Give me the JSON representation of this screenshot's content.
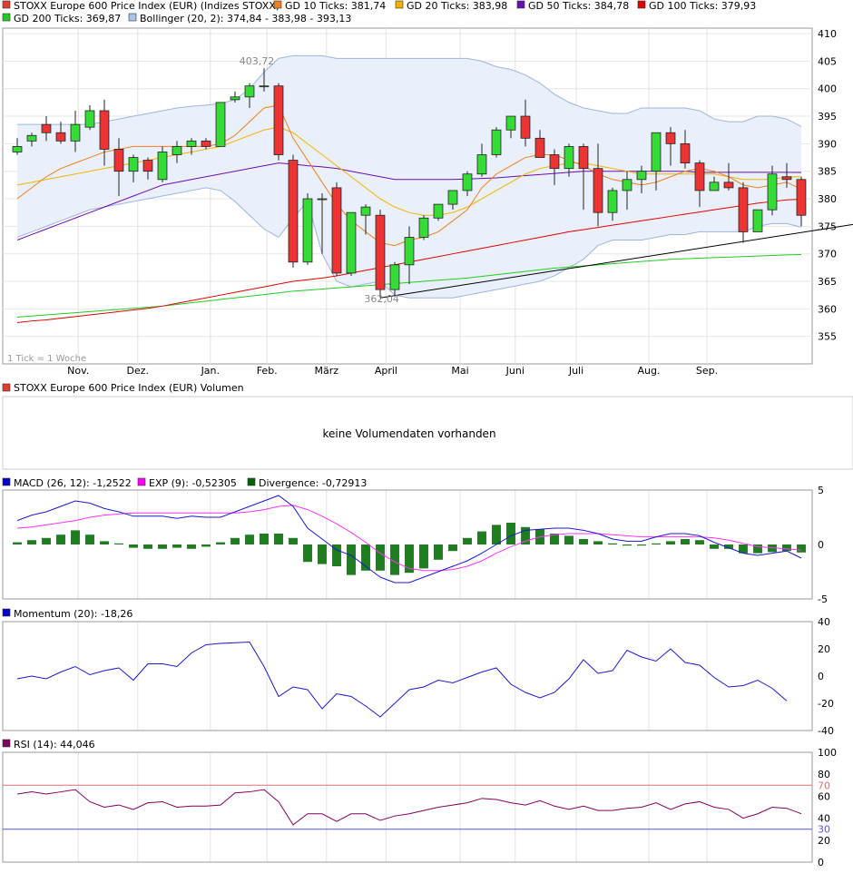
{
  "legend_main": [
    {
      "label": "STOXX Europe 600 Price Index (EUR) (Indizes STOXX)",
      "color": "#e03c31"
    },
    {
      "label": "GD 10 Ticks: 381,74",
      "color": "#f07f1f"
    },
    {
      "label": "GD 20 Ticks: 383,98",
      "color": "#f0b400"
    },
    {
      "label": "GD 50 Ticks: 384,78",
      "color": "#6a0dad"
    },
    {
      "label": "GD 100 Ticks: 379,93",
      "color": "#e00000"
    },
    {
      "label": "GD 200 Ticks: 369,87",
      "color": "#22cc22"
    },
    {
      "label": "Bollinger (20, 2): 374,84 - 383,98 - 393,13",
      "color": "#a9c4e8"
    }
  ],
  "price_axis": [
    "410",
    "405",
    "400",
    "395",
    "390",
    "385",
    "380",
    "375",
    "370",
    "365",
    "360",
    "355"
  ],
  "months": [
    "Nov.",
    "Dez.",
    "Jan.",
    "Feb.",
    "März",
    "April",
    "Mai",
    "Juni",
    "Juli",
    "Aug.",
    "Sep."
  ],
  "tick_note": "1 Tick = 1 Woche",
  "high_label": "403,72",
  "low_label": "362,04",
  "volume_title": "STOXX Europe 600 Price Index (EUR) Volumen",
  "volume_empty": "keine Volumendaten vorhanden",
  "macd_legend": [
    {
      "label": "MACD (26, 12): -1,2522",
      "color": "#0000cc"
    },
    {
      "label": "EXP (9): -0,52305",
      "color": "#ff00ff"
    },
    {
      "label": "Divergence: -0,72913",
      "color": "#006400"
    }
  ],
  "macd_axis": [
    "5",
    "0",
    "-5"
  ],
  "momentum_legend": {
    "label": "Momentum (20): -18,26",
    "color": "#0000cc"
  },
  "momentum_axis": [
    "40",
    "20",
    "0",
    "-20",
    "-40"
  ],
  "rsi_legend": {
    "label": "RSI (14): 44,046",
    "color": "#800060"
  },
  "rsi_axis": [
    "100",
    "80",
    "70",
    "60",
    "40",
    "30",
    "20",
    "0"
  ],
  "chart_data": [
    {
      "type": "candlestick",
      "title": "STOXX Europe 600 Price Index (EUR) (Indizes STOXX)",
      "ylim": [
        350,
        411
      ],
      "grid": true,
      "candles": [
        [
          388.5,
          391,
          388,
          389.5
        ],
        [
          390.5,
          392,
          389.5,
          391.5
        ],
        [
          393.5,
          395,
          390.5,
          392
        ],
        [
          392,
          394,
          390,
          390.5
        ],
        [
          390.5,
          396,
          388.5,
          393.5
        ],
        [
          393,
          397,
          392.5,
          396
        ],
        [
          396,
          398,
          386,
          389
        ],
        [
          389,
          391,
          380.5,
          385
        ],
        [
          385,
          388,
          383,
          387.5
        ],
        [
          387,
          387.5,
          383.5,
          385
        ],
        [
          383.5,
          389.5,
          383,
          388.5
        ],
        [
          388,
          390.5,
          386.5,
          389.5
        ],
        [
          389.5,
          391,
          388,
          390.5
        ],
        [
          390.5,
          391,
          389,
          389.5
        ],
        [
          389.5,
          396.5,
          389.5,
          397.5
        ],
        [
          398,
          399.5,
          397.5,
          398.5
        ],
        [
          398.5,
          401,
          396.5,
          400.5
        ],
        [
          400.5,
          403.7,
          399.5,
          400.5
        ],
        [
          400.5,
          401,
          387,
          388
        ],
        [
          387,
          388,
          367.5,
          368.5
        ],
        [
          368.5,
          381,
          368,
          380
        ],
        [
          380,
          381,
          370,
          380
        ],
        [
          382,
          383,
          366,
          366.5
        ],
        [
          366.5,
          377,
          366,
          377.5
        ],
        [
          377,
          379,
          373.5,
          378.5
        ],
        [
          377,
          378,
          362,
          363.5
        ],
        [
          363.5,
          368.5,
          362.5,
          368
        ],
        [
          368,
          375,
          364.5,
          373
        ],
        [
          373,
          377,
          372.5,
          376.5
        ],
        [
          376.5,
          379,
          376,
          379
        ],
        [
          379,
          381,
          378,
          381.5
        ],
        [
          381.5,
          385,
          380.5,
          384.5
        ],
        [
          384.5,
          390,
          384,
          388
        ],
        [
          388,
          393,
          387.5,
          392.5
        ],
        [
          392.5,
          395,
          391,
          395
        ],
        [
          395,
          398,
          389.5,
          391
        ],
        [
          391,
          392.5,
          387.5,
          387.5
        ],
        [
          388,
          389,
          382.5,
          385.5
        ],
        [
          385.5,
          390,
          384,
          389.5
        ],
        [
          389.5,
          390,
          378,
          385.5
        ],
        [
          385.5,
          390,
          375,
          377.5
        ],
        [
          377.5,
          382,
          376,
          381.5
        ],
        [
          381.5,
          385,
          378,
          383.5
        ],
        [
          383.5,
          386,
          381,
          385
        ],
        [
          385,
          388,
          381.5,
          392
        ],
        [
          392,
          393,
          386,
          390
        ],
        [
          390,
          392.5,
          385.5,
          386.5
        ],
        [
          386.5,
          387,
          378.5,
          381.5
        ],
        [
          381.5,
          384,
          381.5,
          383
        ],
        [
          383,
          386.5,
          381.5,
          382
        ],
        [
          382,
          383,
          372,
          374
        ],
        [
          374,
          377.5,
          374,
          378
        ],
        [
          378,
          386,
          377,
          384.5
        ],
        [
          384,
          386.5,
          382,
          383.5
        ],
        [
          383.5,
          384,
          375,
          377
        ]
      ],
      "gd10": [
        380,
        382,
        384,
        385.5,
        386.5,
        387.5,
        388.5,
        389,
        389.5,
        389.5,
        389.5,
        389.5,
        389.5,
        389.5,
        390,
        391.5,
        394,
        396.5,
        397,
        391,
        387,
        383,
        379,
        376,
        374,
        372,
        371.5,
        372.5,
        373,
        374,
        376,
        378,
        382,
        384.5,
        386,
        387.5,
        388,
        388,
        387,
        386,
        384.5,
        383.5,
        383,
        382.5,
        383,
        384,
        385,
        385.5,
        385,
        384,
        382.5,
        382,
        382.5,
        383,
        381.74
      ],
      "gd20": [
        382.5,
        383,
        383.5,
        384,
        384.5,
        385,
        385.5,
        386,
        386.5,
        387,
        387.5,
        388,
        388.5,
        389,
        389.5,
        390.5,
        391.5,
        392.5,
        393,
        392,
        390,
        388,
        386,
        384,
        382,
        380,
        378.5,
        377.5,
        377,
        377,
        377.5,
        378.5,
        380,
        381.5,
        383,
        384.5,
        385.5,
        386,
        386.5,
        386.5,
        386,
        385.5,
        385,
        384.5,
        384.5,
        384.5,
        384.5,
        384.5,
        384.5,
        384,
        383.5,
        383.5,
        383.5,
        384,
        383.98
      ],
      "gd50": [
        372.5,
        373.5,
        374.5,
        375.5,
        376.5,
        377.5,
        378.5,
        379.5,
        380.5,
        381.5,
        382.5,
        383,
        383.5,
        384,
        384.5,
        385,
        385.5,
        386,
        386.5,
        386.3,
        386,
        385.8,
        385.5,
        385,
        384.5,
        384,
        383.5,
        383.5,
        383.5,
        383.5,
        383.5,
        383.6,
        383.7,
        383.8,
        384,
        384.2,
        384.4,
        384.6,
        384.8,
        385,
        385,
        385,
        385,
        385,
        385,
        385,
        385,
        384.8,
        384.8,
        384.8,
        384.8,
        384.8,
        384.8,
        384.8,
        384.78
      ],
      "gd100": [
        357.5,
        357.8,
        358,
        358.3,
        358.6,
        358.9,
        359.2,
        359.5,
        359.8,
        360.1,
        360.5,
        361,
        361.5,
        362,
        362.5,
        363,
        363.5,
        364,
        364.5,
        365,
        365.3,
        365.6,
        366,
        366.5,
        367,
        367.5,
        368,
        368.5,
        369,
        369.5,
        370,
        370.5,
        371,
        371.5,
        372,
        372.5,
        373,
        373.5,
        374,
        374.4,
        374.8,
        375.2,
        375.6,
        376,
        376.4,
        376.8,
        377.2,
        377.6,
        378,
        378.4,
        378.8,
        379.2,
        379.5,
        379.8,
        379.93
      ],
      "gd200": [
        358.5,
        358.7,
        358.9,
        359.1,
        359.3,
        359.5,
        359.7,
        359.9,
        360.1,
        360.3,
        360.5,
        360.8,
        361.1,
        361.4,
        361.7,
        362,
        362.3,
        362.6,
        362.9,
        363.2,
        363.4,
        363.6,
        363.8,
        364,
        364.2,
        364.4,
        364.6,
        364.8,
        365,
        365.2,
        365.4,
        365.6,
        365.9,
        366.2,
        366.5,
        366.8,
        367.1,
        367.4,
        367.6,
        367.8,
        368,
        368.2,
        368.4,
        368.6,
        368.8,
        369,
        369.1,
        369.2,
        369.3,
        369.4,
        369.5,
        369.6,
        369.7,
        369.8,
        369.87
      ],
      "boll_upper": [
        393.5,
        393.5,
        393.5,
        393.5,
        393.5,
        393.5,
        394,
        394.5,
        395,
        395.5,
        396,
        396.5,
        396.8,
        397,
        397.3,
        398,
        400,
        403,
        405.5,
        406,
        406,
        406,
        405.5,
        405.5,
        405.5,
        405.5,
        405.5,
        405.5,
        405.5,
        405.5,
        405.5,
        405.5,
        405,
        404,
        403.5,
        402.5,
        401,
        399,
        397.5,
        396.5,
        396,
        395.5,
        395.5,
        396.5,
        396.5,
        396.5,
        396.5,
        396,
        394.5,
        394,
        394,
        395,
        395,
        394.5,
        393.13
      ],
      "boll_lower": [
        373,
        374,
        375,
        376,
        377,
        378,
        378.5,
        379,
        379.5,
        380,
        380.5,
        381,
        381.5,
        382,
        381.5,
        379.5,
        377,
        374.5,
        373,
        376.5,
        379.5,
        370,
        365,
        364,
        364.5,
        365,
        362.5,
        362,
        362,
        362,
        362,
        362.5,
        363,
        363.5,
        364,
        364.5,
        365,
        366,
        367.5,
        369,
        371.5,
        372.5,
        372.5,
        372.5,
        373,
        373.5,
        373.5,
        374,
        374,
        374,
        374,
        375,
        375.5,
        375.5,
        374.84
      ],
      "trendline": [
        [
          25,
          362
        ],
        [
          55,
          374.5
        ]
      ]
    },
    {
      "type": "line",
      "title": "MACD (26, 12)",
      "ylim": [
        -5,
        5
      ],
      "macd": [
        2.2,
        2.7,
        3,
        3.5,
        4,
        3.8,
        3.3,
        3,
        2.6,
        2.6,
        2.6,
        2.4,
        2.6,
        2.5,
        2.5,
        3,
        3.5,
        4,
        4.5,
        3.5,
        1.5,
        0.5,
        -0.5,
        -1,
        -2,
        -3,
        -3.5,
        -3.5,
        -3,
        -2.5,
        -2,
        -1.5,
        -0.8,
        0,
        0.8,
        1.3,
        1.4,
        1.5,
        1.5,
        1.3,
        1,
        0.5,
        0.3,
        0.3,
        0.7,
        1,
        1,
        0.8,
        0.2,
        -0.3,
        -0.8,
        -1,
        -0.8,
        -0.6,
        -1.25
      ],
      "exp": [
        1.5,
        1.6,
        1.8,
        2,
        2.2,
        2.5,
        2.7,
        2.8,
        2.9,
        2.9,
        2.9,
        2.9,
        2.9,
        2.9,
        2.9,
        2.9,
        3,
        3.2,
        3.5,
        3.6,
        3.2,
        2.6,
        1.9,
        1.1,
        0.2,
        -0.8,
        -1.6,
        -2.2,
        -2.4,
        -2.4,
        -2.3,
        -2,
        -1.5,
        -0.8,
        -0.2,
        0.3,
        0.7,
        0.9,
        1,
        1,
        1,
        0.9,
        0.8,
        0.7,
        0.7,
        0.7,
        0.7,
        0.7,
        0.6,
        0.4,
        0.1,
        -0.2,
        -0.3,
        -0.4,
        -0.52
      ],
      "divergence": [
        0.2,
        0.4,
        0.6,
        0.9,
        1.3,
        0.9,
        0.3,
        0.1,
        -0.3,
        -0.4,
        -0.4,
        -0.3,
        -0.4,
        -0.2,
        0.2,
        0.6,
        0.9,
        1,
        1,
        0.6,
        -1.6,
        -1.8,
        -2,
        -2.8,
        -2.4,
        -2.4,
        -2.8,
        -2.6,
        -2.2,
        -1.4,
        -0.6,
        0.6,
        1.2,
        1.8,
        2,
        1.6,
        1.4,
        1,
        0.8,
        0.5,
        0.3,
        0.1,
        -0.1,
        -0.1,
        0.1,
        0.3,
        0.5,
        0.4,
        -0.4,
        -0.4,
        -0.8,
        -0.8,
        -0.7,
        -0.6,
        -0.73
      ]
    },
    {
      "type": "line",
      "title": "Momentum (20)",
      "ylim": [
        -40,
        40
      ],
      "values": [
        -2,
        0,
        -2,
        3,
        7,
        1,
        4,
        6,
        -3,
        9,
        9,
        7,
        17,
        23,
        24,
        24.5,
        25,
        7,
        -15,
        -8,
        -10,
        -24,
        -13,
        -15,
        -22,
        -30,
        -20,
        -10,
        -8,
        -3,
        -5,
        -1,
        3,
        6,
        -6,
        -12,
        -16,
        -12,
        -2,
        12,
        2,
        4,
        19,
        14,
        11,
        20,
        10,
        8,
        -1,
        -8,
        -7,
        -3,
        -9,
        -18.26
      ]
    },
    {
      "type": "line",
      "title": "RSI (14)",
      "ylim": [
        0,
        100
      ],
      "reference_lines": [
        70,
        30
      ],
      "values": [
        62,
        64,
        62,
        64,
        66,
        55,
        50,
        52,
        48,
        54,
        55,
        50,
        51,
        51,
        52,
        63,
        64,
        66,
        55,
        34,
        44,
        44,
        37,
        44,
        44,
        38,
        42,
        44,
        47,
        50,
        52,
        54,
        58,
        57,
        54,
        52,
        56,
        51,
        48,
        51,
        47,
        47,
        49,
        50,
        54,
        48,
        53,
        55,
        50,
        48,
        40,
        44,
        50,
        49,
        44.05
      ]
    }
  ]
}
